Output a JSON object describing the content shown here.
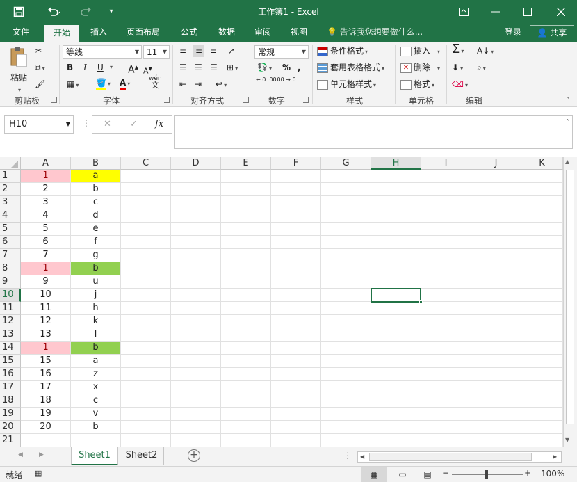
{
  "titlebar": {
    "title": "工作簿1 - Excel",
    "save_icon": "save-icon",
    "undo_icon": "undo-icon",
    "redo_icon": "redo-icon",
    "customize_icon": "customize-toolbar-icon",
    "ribbon_display_icon": "ribbon-display-icon",
    "minimize_icon": "minimize-icon",
    "maximize_icon": "maximize-icon",
    "close_icon": "close-icon"
  },
  "tabs": [
    "文件",
    "开始",
    "插入",
    "页面布局",
    "公式",
    "数据",
    "审阅",
    "视图"
  ],
  "active_tab": "开始",
  "tell_me": "告诉我您想要做什么...",
  "login": "登录",
  "share": "共享",
  "ribbon": {
    "clipboard": {
      "paste": "粘贴",
      "label": "剪贴板"
    },
    "font": {
      "name": "等线",
      "size": "11",
      "bold": "B",
      "italic": "I",
      "underline": "U",
      "grow": "A",
      "shrink": "A",
      "wen": "wén",
      "wen_char": "文",
      "label": "字体"
    },
    "alignment": {
      "label": "对齐方式"
    },
    "number": {
      "format": "常规",
      "percent": "%",
      "comma": ",",
      "inc": "←.0 .00",
      "dec": ".00 →.0",
      "label": "数字"
    },
    "styles": {
      "conditional": "条件格式",
      "table": "套用表格格式",
      "cell": "单元格样式",
      "label": "样式"
    },
    "cells": {
      "insert": "插入",
      "delete": "删除",
      "format": "格式",
      "label": "单元格"
    },
    "editing": {
      "label": "编辑"
    }
  },
  "formula": {
    "namebox": "H10",
    "cancel": "✕",
    "enter": "✓",
    "fx": "fx",
    "content": ""
  },
  "columns": [
    "A",
    "B",
    "C",
    "D",
    "E",
    "F",
    "G",
    "H",
    "I",
    "J",
    "K"
  ],
  "selected_column": "H",
  "selected_row": "10",
  "rows": [
    {
      "n": "1",
      "a": "1",
      "b": "a",
      "a_bg": "#ffc7ce",
      "a_fg": "#9c0006",
      "b_bg": "#ffff00"
    },
    {
      "n": "2",
      "a": "2",
      "b": "b"
    },
    {
      "n": "3",
      "a": "3",
      "b": "c"
    },
    {
      "n": "4",
      "a": "4",
      "b": "d"
    },
    {
      "n": "5",
      "a": "5",
      "b": "e"
    },
    {
      "n": "6",
      "a": "6",
      "b": "f"
    },
    {
      "n": "7",
      "a": "7",
      "b": "g"
    },
    {
      "n": "8",
      "a": "1",
      "b": "b",
      "a_bg": "#ffc7ce",
      "a_fg": "#9c0006",
      "b_bg": "#92d050"
    },
    {
      "n": "9",
      "a": "9",
      "b": "u"
    },
    {
      "n": "10",
      "a": "10",
      "b": "j"
    },
    {
      "n": "11",
      "a": "11",
      "b": "h"
    },
    {
      "n": "12",
      "a": "12",
      "b": "k"
    },
    {
      "n": "13",
      "a": "13",
      "b": "l"
    },
    {
      "n": "14",
      "a": "1",
      "b": "b",
      "a_bg": "#ffc7ce",
      "a_fg": "#9c0006",
      "b_bg": "#92d050"
    },
    {
      "n": "15",
      "a": "15",
      "b": "a"
    },
    {
      "n": "16",
      "a": "16",
      "b": "z"
    },
    {
      "n": "17",
      "a": "17",
      "b": "x"
    },
    {
      "n": "18",
      "a": "18",
      "b": "c"
    },
    {
      "n": "19",
      "a": "19",
      "b": "v"
    },
    {
      "n": "20",
      "a": "20",
      "b": "b"
    },
    {
      "n": "21",
      "a": "",
      "b": ""
    }
  ],
  "sheets": [
    "Sheet1",
    "Sheet2"
  ],
  "active_sheet": "Sheet1",
  "status": {
    "ready": "就绪",
    "zoom": "100%"
  },
  "colors": {
    "brand": "#217346",
    "selection": "#217346"
  }
}
